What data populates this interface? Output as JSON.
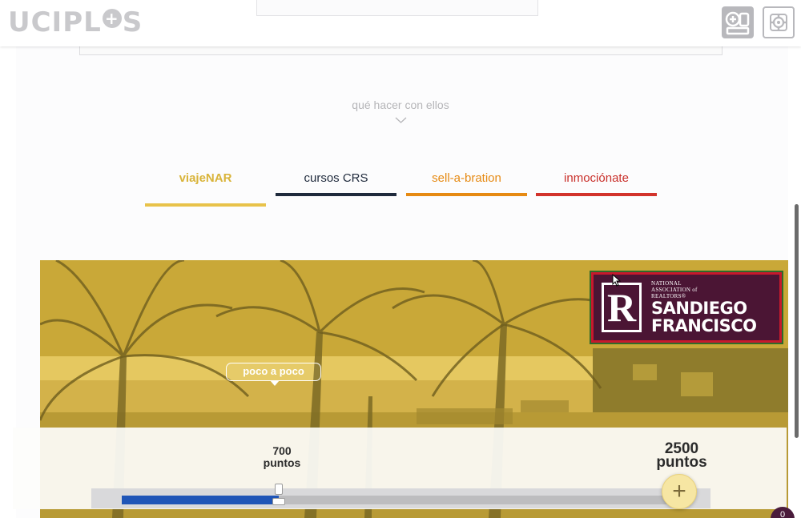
{
  "header": {
    "logo_text_a": "UCIPL",
    "logo_plus": "+",
    "logo_text_b": "S",
    "add_icon": "add-device-icon",
    "settings_icon": "settings-gear-icon"
  },
  "section": {
    "subtitle": "qué hacer con ellos",
    "chevron_icon": "chevron-down-icon"
  },
  "tabs": [
    {
      "label": "viajeNAR",
      "color": "#e8c24a",
      "text_color": "#d9b43a",
      "active": true
    },
    {
      "label": "cursos CRS",
      "color": "#1f2a3c",
      "text_color": "#1f2a3c",
      "active": false
    },
    {
      "label": "sell-a-bration",
      "color": "#e68a13",
      "text_color": "#e68a13",
      "active": false
    },
    {
      "label": "inmociónate",
      "color": "#d2332c",
      "text_color": "#c9302b",
      "active": false
    }
  ],
  "hero": {
    "bubble": "poco a poco",
    "logo": {
      "line1": "NATIONAL",
      "line2": "ASSOCIATION of",
      "line3": "REALTORS®",
      "line4": "SANDIEGO",
      "line5": "FRANCISCO",
      "mark": "R"
    }
  },
  "points": {
    "current_value": "700",
    "current_unit": "puntos",
    "goal_value": "2500",
    "goal_unit": "puntos",
    "progress_fraction": 0.28,
    "add_label": "+"
  },
  "badge": "0"
}
